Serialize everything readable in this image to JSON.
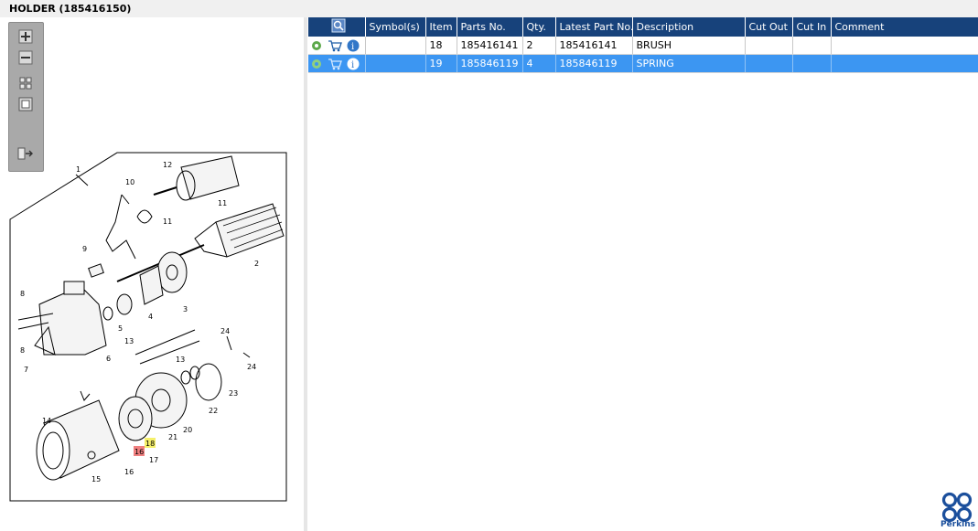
{
  "window": {
    "title": "HOLDER (185416150)"
  },
  "zoom_toolbox": {
    "zoom_in_label": "Zoom in",
    "zoom_out_label": "Zoom out",
    "fit_label": "Fit to window",
    "actual_size_label": "Actual size",
    "export_label": "Export"
  },
  "diagram": {
    "callouts": [
      "1",
      "2",
      "3",
      "4",
      "5",
      "6",
      "7",
      "8",
      "8",
      "9",
      "10",
      "11",
      "11",
      "12",
      "13",
      "13",
      "14",
      "15",
      "16",
      "16",
      "17",
      "18",
      "20",
      "21",
      "22",
      "23",
      "24",
      "24"
    ],
    "highlighted_callouts": [
      {
        "label": "16",
        "color": "#f08080"
      },
      {
        "label": "18",
        "color": "#f5f06a"
      }
    ]
  },
  "table": {
    "columns": [
      "Symbol(s)",
      "Item",
      "Parts No.",
      "Qty.",
      "Latest Part No.",
      "Description",
      "Cut Out",
      "Cut In",
      "Comment"
    ],
    "rows": [
      {
        "symbols": "",
        "item": "18",
        "parts_no": "185416141",
        "qty": "2",
        "latest_part_no": "185416141",
        "description": "BRUSH",
        "cut_out": "",
        "cut_in": "",
        "comment": "",
        "selected": false
      },
      {
        "symbols": "",
        "item": "19",
        "parts_no": "185846119",
        "qty": "4",
        "latest_part_no": "185846119",
        "description": "SPRING",
        "cut_out": "",
        "cut_in": "",
        "comment": "",
        "selected": true
      }
    ]
  },
  "brand": {
    "name": "Perkins",
    "color": "#1b4f9c"
  },
  "colors": {
    "header_bg": "#17427b",
    "selected_row": "#3c96f2"
  }
}
